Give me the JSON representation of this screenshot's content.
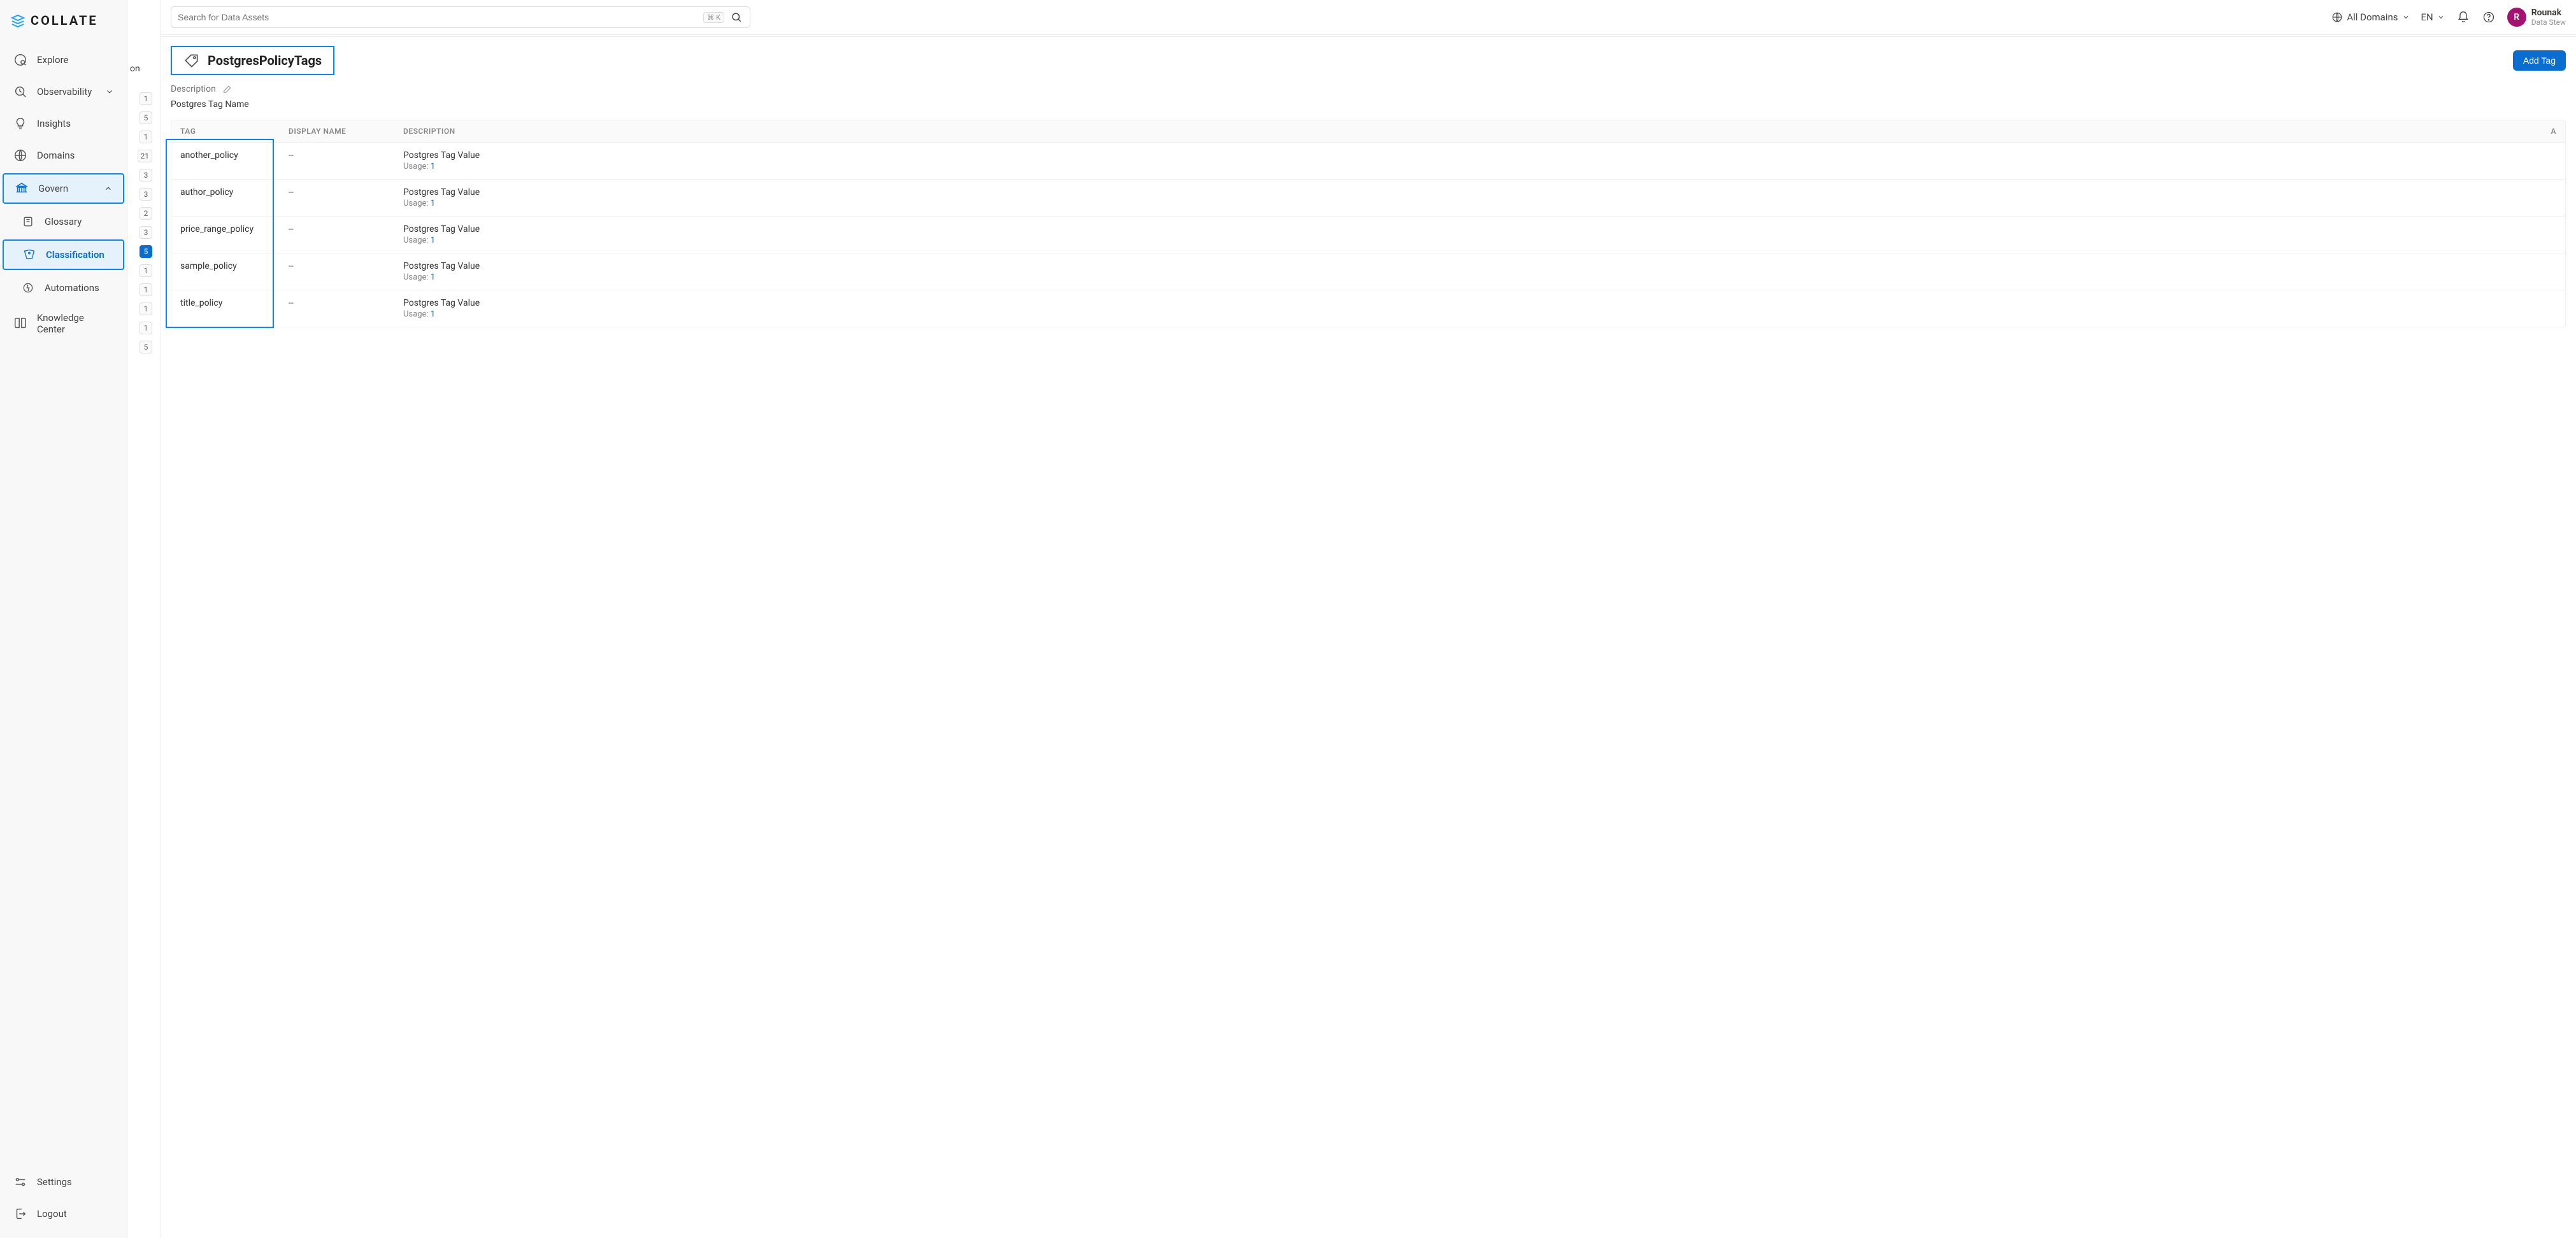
{
  "brand": {
    "name": "COLLATE"
  },
  "search": {
    "placeholder": "Search for Data Assets",
    "shortcut_cmd": "⌘",
    "shortcut_key": "K"
  },
  "topbar": {
    "domains_label": "All Domains",
    "lang_label": "EN"
  },
  "user": {
    "initial": "R",
    "name": "Rounak",
    "role": "Data Stew"
  },
  "sidebar": {
    "explore": "Explore",
    "observability": "Observability",
    "insights": "Insights",
    "domains": "Domains",
    "govern": "Govern",
    "glossary": "Glossary",
    "classification": "Classification",
    "automations": "Automations",
    "knowledge": "Knowledge Center",
    "settings": "Settings",
    "logout": "Logout"
  },
  "side_panel": {
    "truncated": "on",
    "counts": [
      "1",
      "5",
      "1",
      "21",
      "3",
      "3",
      "2",
      "3",
      "5",
      "1",
      "1",
      "1",
      "1",
      "5"
    ],
    "active_index": 8
  },
  "page": {
    "title": "PostgresPolicyTags",
    "add_tag": "Add Tag",
    "description_label": "Description",
    "description_value": "Postgres Tag Name"
  },
  "table": {
    "headers": {
      "tag": "TAG",
      "display": "DISPLAY NAME",
      "desc": "DESCRIPTION",
      "actions": "A"
    },
    "usage_label": "Usage:",
    "rows": [
      {
        "tag": "another_policy",
        "display": "--",
        "desc": "Postgres Tag Value",
        "usage": "1"
      },
      {
        "tag": "author_policy",
        "display": "--",
        "desc": "Postgres Tag Value",
        "usage": "1"
      },
      {
        "tag": "price_range_policy",
        "display": "--",
        "desc": "Postgres Tag Value",
        "usage": "1"
      },
      {
        "tag": "sample_policy",
        "display": "--",
        "desc": "Postgres Tag Value",
        "usage": "1"
      },
      {
        "tag": "title_policy",
        "display": "--",
        "desc": "Postgres Tag Value",
        "usage": "1"
      }
    ]
  }
}
